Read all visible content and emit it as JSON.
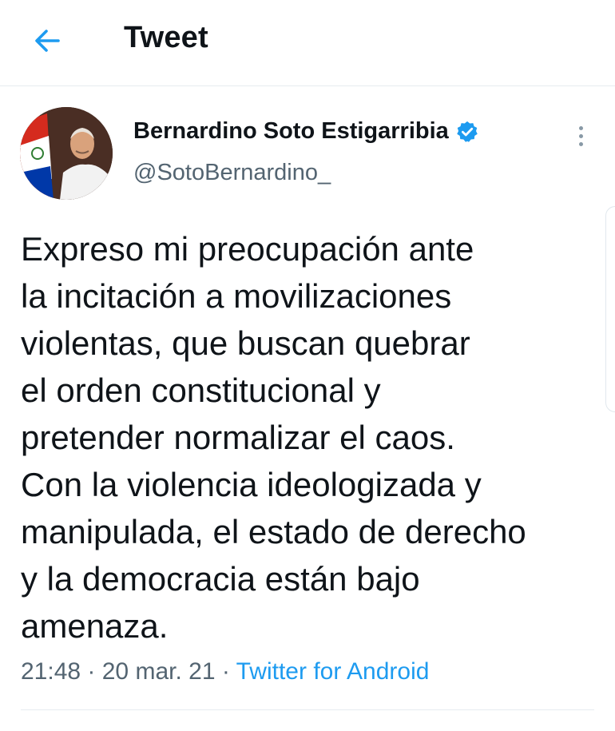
{
  "header": {
    "title": "Tweet",
    "back_icon": "arrow-left-icon",
    "accent": "#1d9bf0"
  },
  "author": {
    "name": "Bernardino Soto Estigarribia",
    "handle": "@SotoBernardino_",
    "verified_icon": "verified-badge-icon",
    "verified_color": "#1d9bf0"
  },
  "tweet": {
    "lines": [
      "Expreso mi preocupación ante",
      "la incitación a movilizaciones",
      "violentas, que buscan quebrar",
      "el orden constitucional y",
      "pretender normalizar el caos.",
      "Con la violencia ideologizada y",
      "manipulada, el estado de derecho",
      "y la democracia están bajo",
      "amenaza."
    ]
  },
  "meta": {
    "time": "21:48",
    "separator": " · ",
    "date": "20 mar. 21",
    "source": "Twitter for Android"
  },
  "more_icon": "more-vertical-icon"
}
